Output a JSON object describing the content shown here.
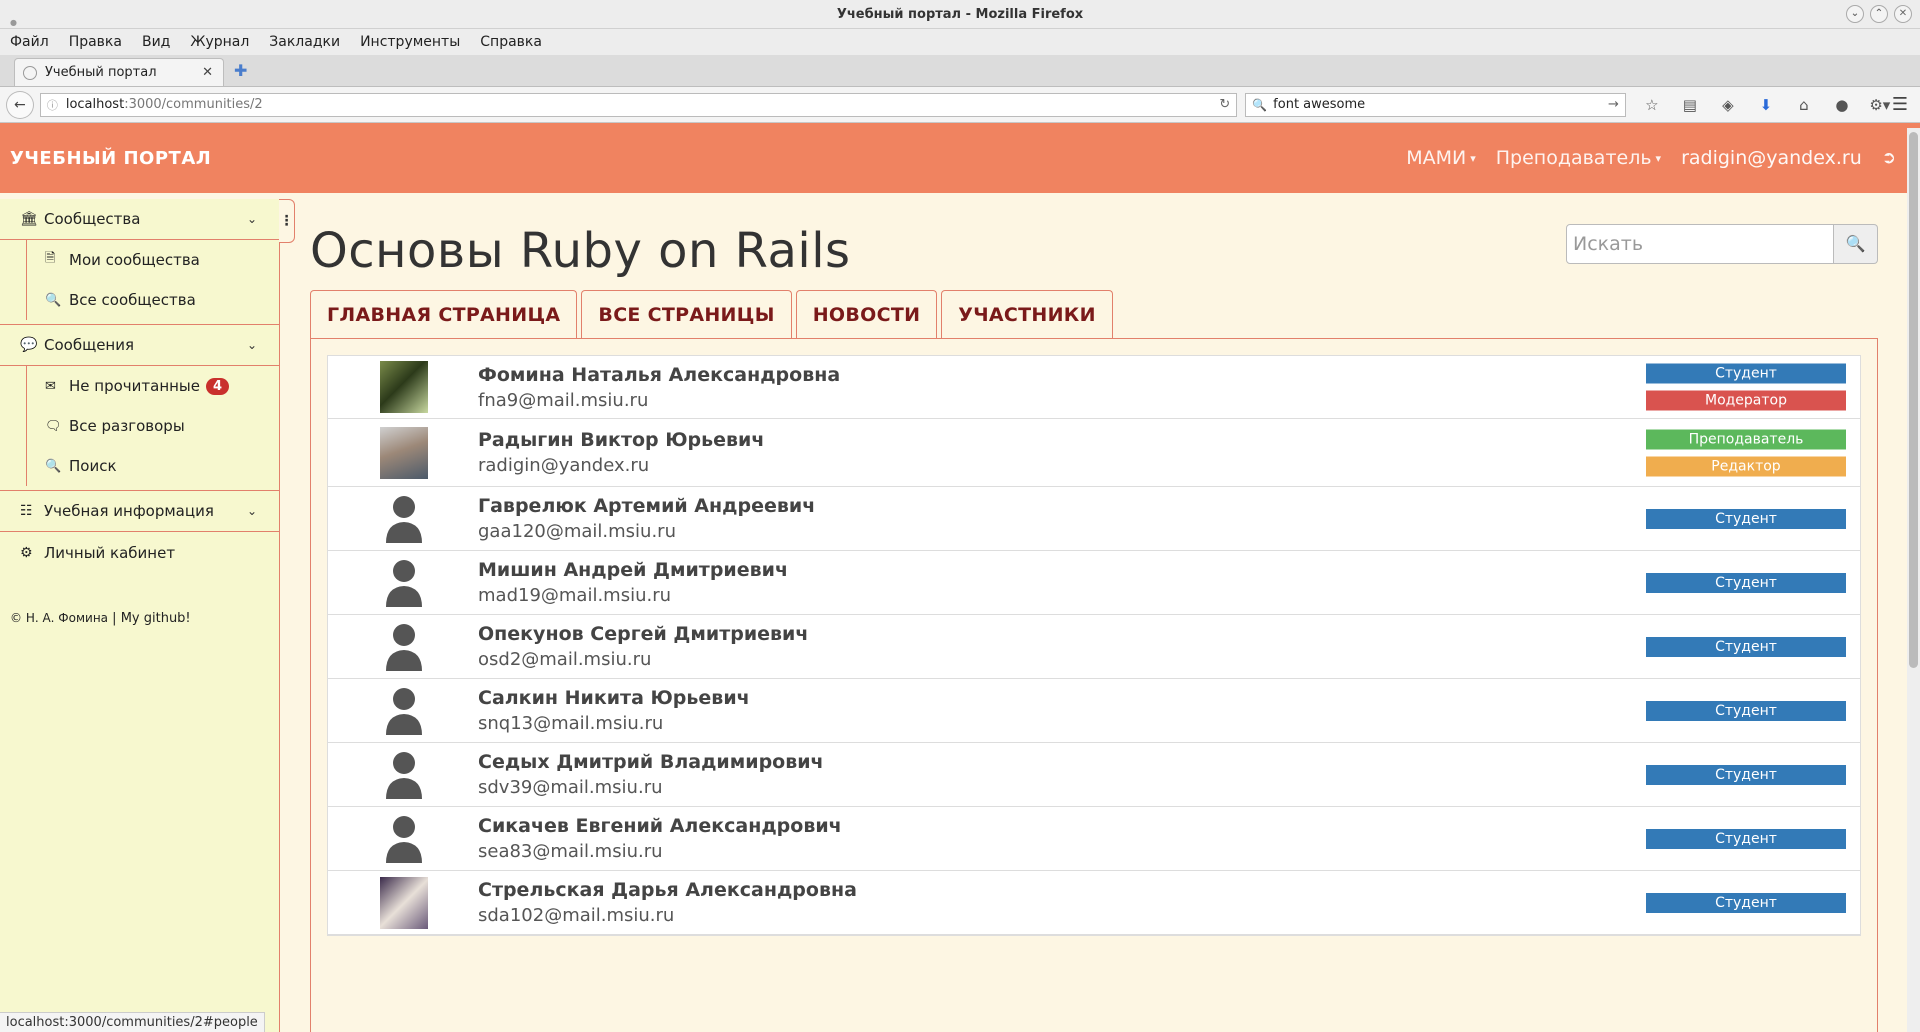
{
  "window": {
    "title": "Учебный портал - Mozilla Firefox"
  },
  "menubar": [
    "Файл",
    "Правка",
    "Вид",
    "Журнал",
    "Закладки",
    "Инструменты",
    "Справка"
  ],
  "browser_tab": {
    "title": "Учебный портал",
    "close": "✕",
    "new_tab": "✚"
  },
  "navbar": {
    "url_host": "localhost",
    "url_path": ":3000/communities/2",
    "search_value": "font awesome"
  },
  "app": {
    "brand": "УЧЕБНЫЙ ПОРТАЛ",
    "nav_org": "МАМИ",
    "nav_role": "Преподаватель",
    "nav_user": "radigin@yandex.ru"
  },
  "sidebar": {
    "communities": "Сообщества",
    "my_communities": "Мои сообщества",
    "all_communities": "Все сообщества",
    "messages": "Сообщения",
    "unread": "Не прочитанные",
    "unread_count": "4",
    "all_conversations": "Все разговоры",
    "search": "Поиск",
    "study_info": "Учебная информация",
    "account": "Личный кабинет",
    "footer_author": "© Н. А. Фомина",
    "footer_sep": "|",
    "footer_link": "My github!"
  },
  "main": {
    "title": "Основы Ruby on Rails",
    "search_placeholder": "Искать",
    "tabs": [
      "ГЛАВНАЯ СТРАНИЦА",
      "ВСЕ СТРАНИЦЫ",
      "НОВОСТИ",
      "УЧАСТНИКИ"
    ],
    "people": [
      {
        "name": "Фомина Наталья Александровна",
        "email": "fna9@mail.msiu.ru",
        "roles": [
          {
            "label": "Студент",
            "kind": "student"
          },
          {
            "label": "Модератор",
            "kind": "moderator"
          }
        ],
        "avatar": "photo1"
      },
      {
        "name": "Радыгин Виктор Юрьевич",
        "email": "radigin@yandex.ru",
        "roles": [
          {
            "label": "Преподаватель",
            "kind": "teacher"
          },
          {
            "label": "Редактор",
            "kind": "editor"
          }
        ],
        "avatar": "photo2"
      },
      {
        "name": "Гаврелюк Артемий Андреевич",
        "email": "gaa120@mail.msiu.ru",
        "roles": [
          {
            "label": "Студент",
            "kind": "student"
          }
        ],
        "avatar": "default"
      },
      {
        "name": "Мишин Андрей Дмитриевич",
        "email": "mad19@mail.msiu.ru",
        "roles": [
          {
            "label": "Студент",
            "kind": "student"
          }
        ],
        "avatar": "default"
      },
      {
        "name": "Опекунов Сергей Дмитриевич",
        "email": "osd2@mail.msiu.ru",
        "roles": [
          {
            "label": "Студент",
            "kind": "student"
          }
        ],
        "avatar": "default"
      },
      {
        "name": "Салкин Никита Юрьевич",
        "email": "snq13@mail.msiu.ru",
        "roles": [
          {
            "label": "Студент",
            "kind": "student"
          }
        ],
        "avatar": "default"
      },
      {
        "name": "Седых Дмитрий Владимирович",
        "email": "sdv39@mail.msiu.ru",
        "roles": [
          {
            "label": "Студент",
            "kind": "student"
          }
        ],
        "avatar": "default"
      },
      {
        "name": "Сикачев Евгений Александрович",
        "email": "sea83@mail.msiu.ru",
        "roles": [
          {
            "label": "Студент",
            "kind": "student"
          }
        ],
        "avatar": "default"
      },
      {
        "name": "Стрельская Дарья Александровна",
        "email": "sda102@mail.msiu.ru",
        "roles": [
          {
            "label": "Студент",
            "kind": "student"
          }
        ],
        "avatar": "photo3"
      }
    ]
  },
  "statusbar": {
    "text": "localhost:3000/communities/2#people"
  },
  "colors": {
    "header": "#f08360",
    "sidebar": "#f7f8cf",
    "student": "#337ab7",
    "moderator": "#d9534f",
    "teacher": "#5cb85c",
    "editor": "#f0ad4e"
  }
}
